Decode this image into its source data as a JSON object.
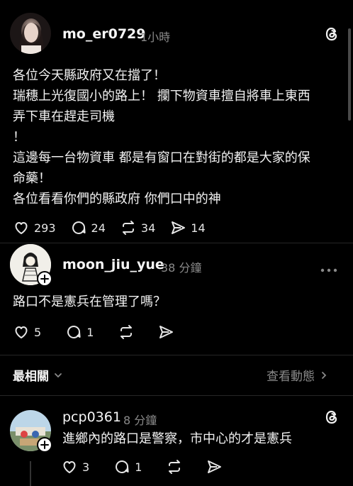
{
  "post": {
    "username": "mo_er0729",
    "time": "1小時",
    "lines": [
      "各位今天縣政府又在擋了！",
      "瑞穗上光復國小的路上！  攔下物資車擅自將車上東西",
      "弄下車在趕走司機",
      "！",
      "這邊每一台物資車 都是有窗口在對街的都是大家的保",
      "命藥！",
      "各位看看你們的縣政府 你們口中的神"
    ],
    "likes": "293",
    "comments": "24",
    "reposts": "34",
    "shares": "14"
  },
  "reply1": {
    "username": "moon_jiu_yue",
    "time": "38 分鐘",
    "text": "路口不是憲兵在管理了嗎？",
    "likes": "5",
    "comments": "1"
  },
  "sort": {
    "label": "最相關",
    "view_activity": "查看動態"
  },
  "reply2": {
    "username": "pcp0361",
    "time": "8 分鐘",
    "text": "進鄉內的路口是警察，市中心的才是憲兵",
    "likes": "3",
    "comments": "1"
  },
  "icons": [
    "threads-icon",
    "heart-icon",
    "comment-icon",
    "repost-icon",
    "share-icon",
    "more-icon",
    "chevron-down-icon",
    "chevron-right-icon",
    "plus-icon"
  ]
}
